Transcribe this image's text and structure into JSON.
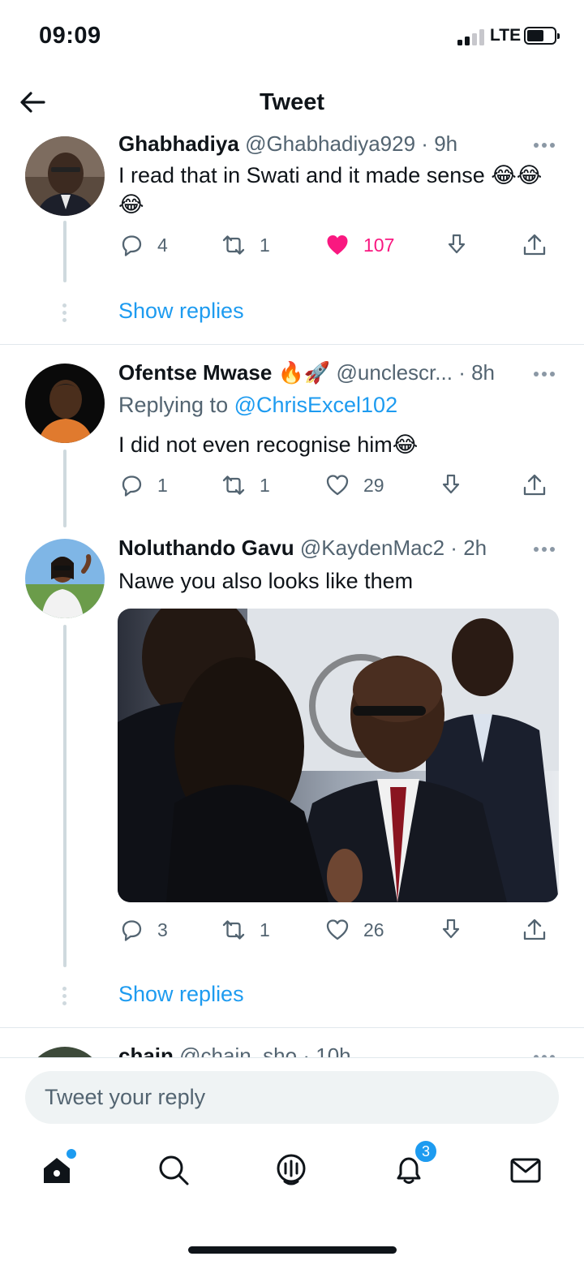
{
  "status_bar": {
    "time": "09:09",
    "network": "LTE"
  },
  "header": {
    "title": "Tweet"
  },
  "tweets": [
    {
      "name": "Ghabhadiya",
      "handle": "@Ghabhadiya929",
      "separator": "·",
      "time": "9h",
      "text": "I read that in Swati and it made sense 😂😂😂",
      "replies": "4",
      "retweets": "1",
      "likes": "107",
      "liked": true,
      "show_replies": "Show replies"
    },
    {
      "name": "Ofentse Mwase 🔥🚀",
      "handle": "@unclescr...",
      "separator": "·",
      "time": "8h",
      "replying_prefix": "Replying to",
      "replying_mention": "@ChrisExcel102",
      "text": "I did not even recognise him😂",
      "replies": "1",
      "retweets": "1",
      "likes": "29",
      "liked": false
    },
    {
      "name": "Noluthando Gavu",
      "handle": "@KaydenMac2",
      "separator": "·",
      "time": "2h",
      "text": "Nawe you also looks like them",
      "replies": "3",
      "retweets": "1",
      "likes": "26",
      "liked": false,
      "show_replies": "Show replies"
    },
    {
      "name": "chain",
      "handle": "@chain_sho",
      "separator": "·",
      "time": "10h"
    }
  ],
  "reply_box": {
    "placeholder": "Tweet your reply"
  },
  "nav": {
    "items": [
      "home-icon",
      "search-icon",
      "spaces-icon",
      "notifications-icon",
      "messages-icon"
    ],
    "notifications_badge": "3"
  },
  "colors": {
    "accent": "#1d9bf0",
    "like": "#f91880",
    "secondary_text": "#536471"
  }
}
